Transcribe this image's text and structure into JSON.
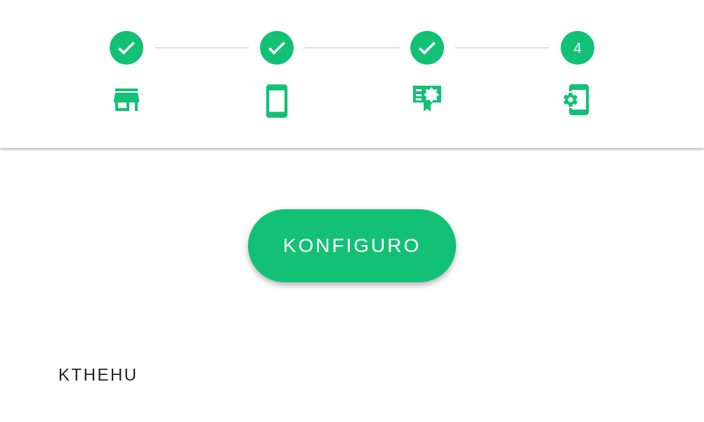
{
  "steps": [
    {
      "kind": "store",
      "completed": true
    },
    {
      "kind": "phone",
      "completed": true
    },
    {
      "kind": "certificate",
      "completed": true
    },
    {
      "kind": "phone-settings",
      "completed": false,
      "number": "4"
    }
  ],
  "primary_button": "KONFIGURO",
  "back_link": "KTHEHU"
}
